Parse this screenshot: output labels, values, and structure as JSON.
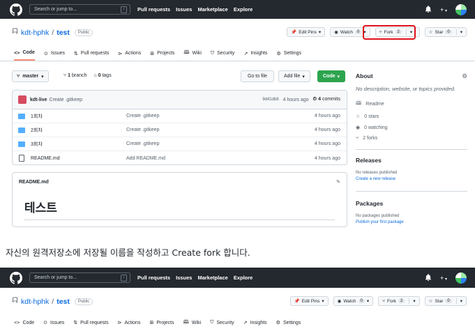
{
  "topbar": {
    "search_placeholder": "Search or jump to...",
    "search_shortcut": "/",
    "nav": [
      "Pull requests",
      "Issues",
      "Marketplace",
      "Explore"
    ],
    "plus_label": "+",
    "bell_icon": "bell-icon"
  },
  "repo": {
    "owner": "kdt-hphk",
    "separator": "/",
    "name": "test",
    "visibility": "Public",
    "edit_pins_label": "Edit Pins",
    "watch_label": "Watch",
    "watch_count": "0",
    "fork_label": "Fork",
    "fork_count": "2",
    "star_label": "Star",
    "star_count": "0"
  },
  "tabs": [
    {
      "label": "Code",
      "icon": "code-icon"
    },
    {
      "label": "Issues",
      "icon": "issue-icon"
    },
    {
      "label": "Pull requests",
      "icon": "pull-request-icon"
    },
    {
      "label": "Actions",
      "icon": "play-icon"
    },
    {
      "label": "Projects",
      "icon": "table-icon"
    },
    {
      "label": "Wiki",
      "icon": "book-icon"
    },
    {
      "label": "Security",
      "icon": "shield-icon"
    },
    {
      "label": "Insights",
      "icon": "graph-icon"
    },
    {
      "label": "Settings",
      "icon": "gear-icon"
    }
  ],
  "toolbar": {
    "branch": "master",
    "branch_count_num": "1",
    "branch_count_word": "branch",
    "tags_num": "0",
    "tags_word": "tags",
    "go_to_file": "Go to file",
    "add_file": "Add file",
    "code": "Code"
  },
  "commit": {
    "user": "kdt-live",
    "message": "Create .gitkeep",
    "sha": "9d41db8",
    "time": "4 hours ago",
    "commits_num": "4",
    "commits_word": "commits"
  },
  "files": [
    {
      "type": "dir",
      "name": "1회차",
      "message": "Create .gitkeep",
      "time": "4 hours ago"
    },
    {
      "type": "dir",
      "name": "2회차",
      "message": "Create .gitkeep",
      "time": "4 hours ago"
    },
    {
      "type": "dir",
      "name": "3회차",
      "message": "Create .gitkeep",
      "time": "4 hours ago"
    },
    {
      "type": "file",
      "name": "README.md",
      "message": "Add README.md",
      "time": "4 hours ago"
    }
  ],
  "readme": {
    "filename": "README.md",
    "heading": "테스트"
  },
  "about": {
    "title": "About",
    "description": "No description, website, or topics provided.",
    "readme_label": "Readme",
    "stars": "0 stars",
    "watching": "0 watching",
    "forks": "2 forks"
  },
  "releases": {
    "title": "Releases",
    "none": "No releases published",
    "create_link": "Create a new release"
  },
  "packages": {
    "title": "Packages",
    "none": "No packages published",
    "publish_link": "Publish your first package"
  },
  "caption": "자신의 원격저장소에 저장될 이름을 작성하고 Create fork 합니다.",
  "colors": {
    "topbar": "#24292f",
    "highlight": "#e0101a",
    "code_button": "#2da44e",
    "folder": "#54aeff"
  }
}
